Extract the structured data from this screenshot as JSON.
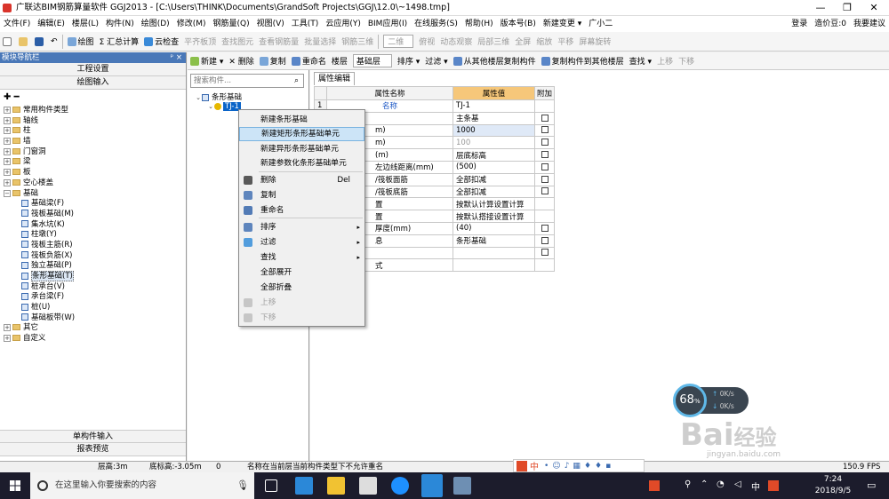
{
  "titlebar": {
    "title": "广联达BIM钢筋算量软件 GGJ2013 - [C:\\Users\\THINK\\Documents\\GrandSoft Projects\\GGJ\\12.0\\~1498.tmp]",
    "minimize": "—",
    "maximize": "❐",
    "close": "✕"
  },
  "menubar": {
    "items": [
      "文件(F)",
      "编辑(E)",
      "楼层(L)",
      "构件(N)",
      "绘图(D)",
      "修改(M)",
      "钢筋量(Q)",
      "视图(V)",
      "工具(T)",
      "云应用(Y)",
      "BIM应用(I)",
      "在线服务(S)",
      "帮助(H)",
      "版本号(B)",
      "新建变更 ▾",
      "广小二"
    ],
    "right": [
      "登录",
      "造价豆:0",
      "我要建议"
    ]
  },
  "toolbar": {
    "items": [
      "绘图",
      "Σ 汇总计算",
      "云检查",
      "平齐板顶",
      "查找图元",
      "查看钢筋量",
      "批量选择",
      "钢筋三维",
      "二维",
      "俯视",
      "动态观察",
      "局部三维",
      "全屏",
      "缩放",
      "平移",
      "屏幕旋转"
    ]
  },
  "navpanel": {
    "header": "模块导航栏",
    "pin": "ᵖ ×",
    "btn_project": "工程设置",
    "btn_draw": "绘图输入",
    "tree": [
      {
        "label": "常用构件类型",
        "level": 0,
        "type": "folder",
        "exp": "+"
      },
      {
        "label": "轴线",
        "level": 0,
        "type": "folder",
        "exp": "+"
      },
      {
        "label": "柱",
        "level": 0,
        "type": "folder",
        "exp": "+"
      },
      {
        "label": "墙",
        "level": 0,
        "type": "folder",
        "exp": "+"
      },
      {
        "label": "门窗洞",
        "level": 0,
        "type": "folder",
        "exp": "+"
      },
      {
        "label": "梁",
        "level": 0,
        "type": "folder",
        "exp": "+"
      },
      {
        "label": "板",
        "level": 0,
        "type": "folder",
        "exp": "+"
      },
      {
        "label": "空心楼盖",
        "level": 0,
        "type": "folder",
        "exp": "+"
      },
      {
        "label": "基础",
        "level": 0,
        "type": "folder",
        "exp": "−"
      },
      {
        "label": "基础梁(F)",
        "level": 1,
        "type": "item"
      },
      {
        "label": "筏板基础(M)",
        "level": 1,
        "type": "item"
      },
      {
        "label": "集水坑(K)",
        "level": 1,
        "type": "item"
      },
      {
        "label": "柱墩(Y)",
        "level": 1,
        "type": "item"
      },
      {
        "label": "筏板主筋(R)",
        "level": 1,
        "type": "item"
      },
      {
        "label": "筏板负筋(X)",
        "level": 1,
        "type": "item"
      },
      {
        "label": "独立基础(P)",
        "level": 1,
        "type": "item"
      },
      {
        "label": "条形基础(T)",
        "level": 1,
        "type": "item",
        "selected": true
      },
      {
        "label": "桩承台(V)",
        "level": 1,
        "type": "item"
      },
      {
        "label": "承台梁(F)",
        "level": 1,
        "type": "item"
      },
      {
        "label": "桩(U)",
        "level": 1,
        "type": "item"
      },
      {
        "label": "基础板带(W)",
        "level": 1,
        "type": "item"
      },
      {
        "label": "其它",
        "level": 0,
        "type": "folder",
        "exp": "+"
      },
      {
        "label": "自定义",
        "level": 0,
        "type": "folder",
        "exp": "+"
      }
    ],
    "btn_single": "单构件输入",
    "btn_report": "报表预览"
  },
  "midtoolbar": {
    "items": [
      "新建 ▾",
      "✕ 删除",
      "复制",
      "重命名",
      "楼层",
      "基础层",
      "排序 ▾",
      "过滤 ▾",
      "从其他楼层复制构件",
      "复制构件到其他楼层",
      "查找 ▾",
      "上移",
      "下移"
    ]
  },
  "component_tree": {
    "search_placeholder": "搜索构件...",
    "root": "条形基础",
    "child": "TJ-1"
  },
  "props": {
    "tab": "属性编辑",
    "headers": [
      "属性名称",
      "属性值",
      "附加"
    ],
    "rows": [
      {
        "num": "1",
        "name": "名称",
        "value": "TJ-1",
        "chk": false
      },
      {
        "num": "",
        "name": "",
        "value": "主条基",
        "chk": true
      },
      {
        "num": "",
        "name": "m)",
        "value": "1000",
        "chk": true
      },
      {
        "num": "",
        "name": "m)",
        "value": "100",
        "chk": true
      },
      {
        "num": "",
        "name": "(m)",
        "value": "层底标高",
        "chk": true
      },
      {
        "num": "",
        "name": "左边线距离(mm)",
        "value": "(500)",
        "chk": true
      },
      {
        "num": "",
        "name": "/筏板面筋",
        "value": "全部扣减",
        "chk": true
      },
      {
        "num": "",
        "name": "/筏板底筋",
        "value": "全部扣减",
        "chk": true
      },
      {
        "num": "",
        "name": "置",
        "value": "按默认计算设置计算",
        "chk": false
      },
      {
        "num": "",
        "name": "置",
        "value": "按默认搭接设置计算",
        "chk": false
      },
      {
        "num": "",
        "name": "厚度(mm)",
        "value": "(40)",
        "chk": true
      },
      {
        "num": "",
        "name": "息",
        "value": "条形基础",
        "chk": true
      },
      {
        "num": "",
        "name": "",
        "value": "",
        "chk": true
      },
      {
        "num": "",
        "name": "式",
        "value": "",
        "chk": false
      }
    ]
  },
  "context_menu": {
    "items": [
      {
        "label": "新建条形基础"
      },
      {
        "label": "新建矩形条形基础单元",
        "highlight": true
      },
      {
        "label": "新建异形条形基础单元"
      },
      {
        "label": "新建参数化条形基础单元"
      },
      {
        "label": "删除",
        "shortcut": "Del",
        "icon": "delete-icon"
      },
      {
        "label": "复制",
        "icon": "copy-icon"
      },
      {
        "label": "重命名",
        "icon": "rename-icon"
      },
      {
        "label": "排序",
        "arrow": "▸",
        "icon": "sort-icon"
      },
      {
        "label": "过滤",
        "arrow": "▸",
        "icon": "filter-icon"
      },
      {
        "label": "查找",
        "arrow": "▸"
      },
      {
        "label": "全部展开"
      },
      {
        "label": "全部折叠"
      },
      {
        "label": "上移",
        "disabled": true,
        "icon": "up-icon"
      },
      {
        "label": "下移",
        "disabled": true,
        "icon": "down-icon"
      }
    ]
  },
  "statusbar": {
    "floor": "层高:3m",
    "bottom": "底标高:-3.05m",
    "zero": "0",
    "message": "名称在当前层当前构件类型下不允许重名",
    "fps": "150.9 FPS"
  },
  "ime": {
    "label": "中"
  },
  "network": {
    "percent": "68",
    "unit": "%",
    "up": "0K/s",
    "down": "0K/s"
  },
  "watermark": {
    "text1": "Bai",
    "text2": "经验",
    "url": "jingyan.baidu.com"
  },
  "taskbar": {
    "search": "在这里输入你要搜索的内容",
    "tray_ime": "中",
    "time": "7:24",
    "date": "2018/9/5"
  },
  "colors": {
    "nav_header": "#4a78b8",
    "prop_value_header": "#f6c77a",
    "selection": "#0a64c8",
    "menu_highlight": "#cce4f7",
    "taskbar": "#1c1c2c",
    "net_ring": "#5fb8e8"
  }
}
